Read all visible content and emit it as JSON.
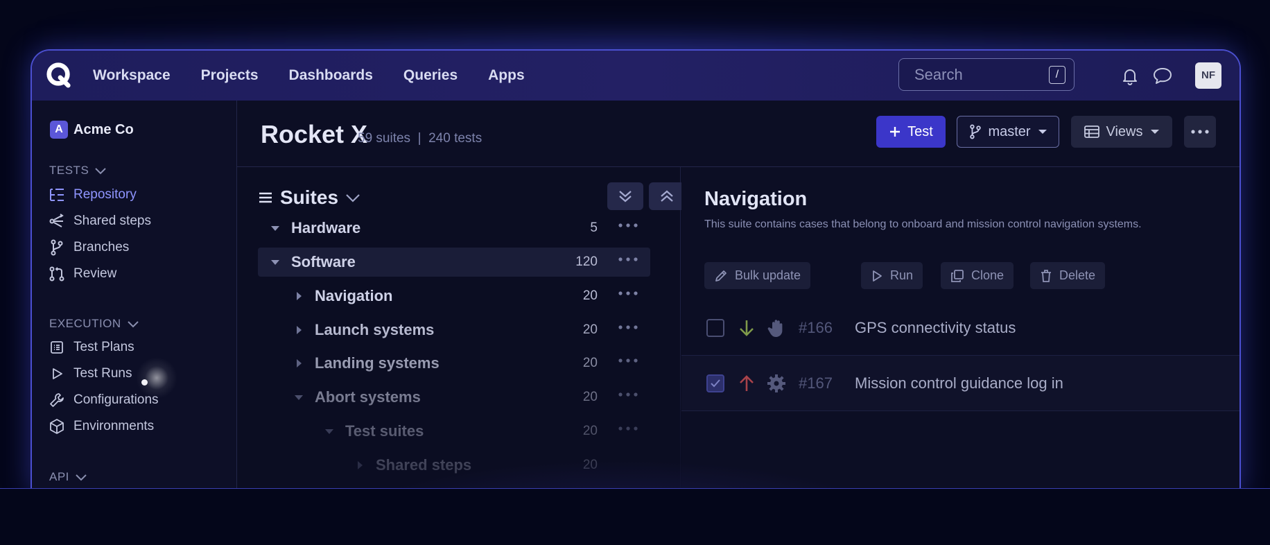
{
  "nav": {
    "items": [
      "Workspace",
      "Projects",
      "Dashboards",
      "Queries",
      "Apps"
    ],
    "search_placeholder": "Search",
    "search_shortcut": "/",
    "avatar_initials": "NF"
  },
  "sidebar": {
    "org_badge": "A",
    "org_name": "Acme Co",
    "tests_heading": "TESTS",
    "tests_items": [
      {
        "label": "Repository",
        "icon": "repository-icon",
        "active": true
      },
      {
        "label": "Shared steps",
        "icon": "shared-steps-icon"
      },
      {
        "label": "Branches",
        "icon": "branch-icon"
      },
      {
        "label": "Review",
        "icon": "review-icon"
      }
    ],
    "execution_heading": "EXECUTION",
    "execution_items": [
      {
        "label": "Test Plans",
        "icon": "test-plans-icon"
      },
      {
        "label": "Test Runs",
        "icon": "play-icon"
      },
      {
        "label": "Configurations",
        "icon": "wrench-icon"
      },
      {
        "label": "Environments",
        "icon": "cube-icon"
      }
    ],
    "api_heading": "API"
  },
  "header": {
    "title": "Rocket X",
    "meta": "59 suites  |  240 tests",
    "test_button": "Test",
    "branch_button": "master",
    "views_button": "Views"
  },
  "suites": {
    "title": "Suites",
    "rows": [
      {
        "name": "Hardware",
        "count": "5",
        "level": 0,
        "expanded": true
      },
      {
        "name": "Software",
        "count": "120",
        "level": 0,
        "expanded": true,
        "selected": true
      },
      {
        "name": "Navigation",
        "count": "20",
        "level": 1,
        "expanded": false
      },
      {
        "name": "Launch systems",
        "count": "20",
        "level": 1,
        "expanded": false
      },
      {
        "name": "Landing systems",
        "count": "20",
        "level": 1,
        "expanded": false
      },
      {
        "name": "Abort systems",
        "count": "20",
        "level": 1,
        "expanded": true
      },
      {
        "name": "Test suites",
        "count": "20",
        "level": 2,
        "expanded": true
      },
      {
        "name": "Shared steps",
        "count": "20",
        "level": 3,
        "expanded": false
      }
    ]
  },
  "detail": {
    "title": "Navigation",
    "description": "This suite contains cases that belong to onboard and mission control navigation systems.",
    "actions": [
      "Bulk update",
      "Run",
      "Clone",
      "Delete"
    ],
    "cases": [
      {
        "id": "#166",
        "title": "GPS connectivity status",
        "checked": false,
        "priority": "low",
        "type": "manual"
      },
      {
        "id": "#167",
        "title": "Mission control guidance log in",
        "checked": true,
        "priority": "high",
        "type": "automated"
      }
    ]
  },
  "colors": {
    "accent": "#3b36c9",
    "active_link": "#8f95ff",
    "priority_low": "#7f9a4a",
    "priority_high": "#a8424a"
  }
}
